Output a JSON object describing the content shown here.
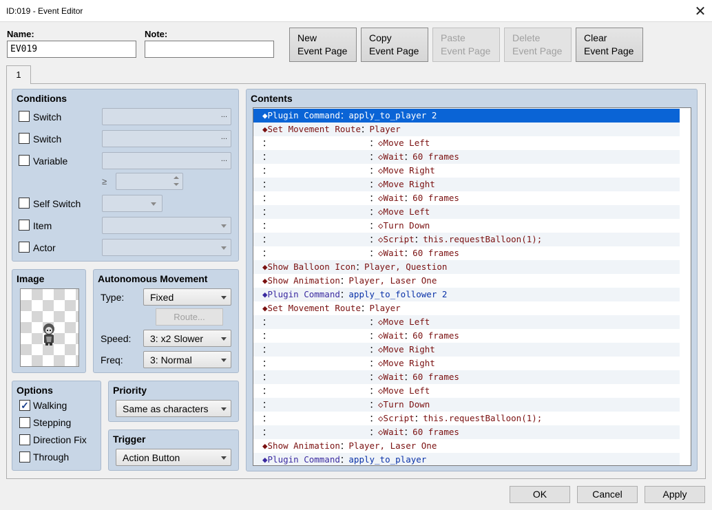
{
  "window": {
    "title": "ID:019 - Event Editor",
    "close_glyph": "✕"
  },
  "header": {
    "name_label": "Name:",
    "name_value": "EV019",
    "note_label": "Note:",
    "note_value": "",
    "buttons": [
      {
        "line1": "New",
        "line2": "Event Page",
        "enabled": true
      },
      {
        "line1": "Copy",
        "line2": "Event Page",
        "enabled": true
      },
      {
        "line1": "Paste",
        "line2": "Event Page",
        "enabled": false
      },
      {
        "line1": "Delete",
        "line2": "Event Page",
        "enabled": false
      },
      {
        "line1": "Clear",
        "line2": "Event Page",
        "enabled": true
      }
    ]
  },
  "tabs": [
    {
      "label": "1"
    }
  ],
  "conditions": {
    "title": "Conditions",
    "switch1_label": "Switch",
    "switch2_label": "Switch",
    "variable_label": "Variable",
    "gte_symbol": "≥",
    "self_switch_label": "Self Switch",
    "item_label": "Item",
    "actor_label": "Actor",
    "ellipsis": "..."
  },
  "image": {
    "title": "Image"
  },
  "autonomous": {
    "title": "Autonomous Movement",
    "type_label": "Type:",
    "type_value": "Fixed",
    "route_button": "Route...",
    "speed_label": "Speed:",
    "speed_value": "3: x2 Slower",
    "freq_label": "Freq:",
    "freq_value": "3: Normal"
  },
  "options": {
    "title": "Options",
    "items": [
      {
        "label": "Walking",
        "checked": true
      },
      {
        "label": "Stepping",
        "checked": false
      },
      {
        "label": "Direction Fix",
        "checked": false
      },
      {
        "label": "Through",
        "checked": false
      }
    ],
    "check_glyph": "✓"
  },
  "priority": {
    "title": "Priority",
    "value": "Same as characters"
  },
  "trigger": {
    "title": "Trigger",
    "value": "Action Button"
  },
  "contents": {
    "title": "Contents",
    "rows": [
      [
        [
          "◆Plugin Command",
          "purple"
        ],
        [
          "：",
          ""
        ],
        [
          "apply_to_player 2",
          "blue"
        ]
      ],
      [
        [
          "◆Set Movement Route",
          "red"
        ],
        [
          "：",
          ""
        ],
        [
          "Player",
          "red"
        ]
      ],
      [
        [
          "：                   ",
          ""
        ],
        [
          "：",
          ""
        ],
        [
          "◇Move Left",
          "red"
        ]
      ],
      [
        [
          "：                   ",
          ""
        ],
        [
          "：",
          ""
        ],
        [
          "◇Wait",
          "red"
        ],
        [
          "：",
          ""
        ],
        [
          "60 frames",
          "red"
        ]
      ],
      [
        [
          "：                   ",
          ""
        ],
        [
          "：",
          ""
        ],
        [
          "◇Move Right",
          "red"
        ]
      ],
      [
        [
          "：                   ",
          ""
        ],
        [
          "：",
          ""
        ],
        [
          "◇Move Right",
          "red"
        ]
      ],
      [
        [
          "：                   ",
          ""
        ],
        [
          "：",
          ""
        ],
        [
          "◇Wait",
          "red"
        ],
        [
          "：",
          ""
        ],
        [
          "60 frames",
          "red"
        ]
      ],
      [
        [
          "：                   ",
          ""
        ],
        [
          "：",
          ""
        ],
        [
          "◇Move Left",
          "red"
        ]
      ],
      [
        [
          "：                   ",
          ""
        ],
        [
          "：",
          ""
        ],
        [
          "◇Turn Down",
          "red"
        ]
      ],
      [
        [
          "：                   ",
          ""
        ],
        [
          "：",
          ""
        ],
        [
          "◇Script",
          "red"
        ],
        [
          "：",
          ""
        ],
        [
          "this.requestBalloon(1);",
          "red"
        ]
      ],
      [
        [
          "：                   ",
          ""
        ],
        [
          "：",
          ""
        ],
        [
          "◇Wait",
          "red"
        ],
        [
          "：",
          ""
        ],
        [
          "60 frames",
          "red"
        ]
      ],
      [
        [
          "◆Show Balloon Icon",
          "red"
        ],
        [
          "：",
          ""
        ],
        [
          "Player, Question",
          "red"
        ]
      ],
      [
        [
          "◆Show Animation",
          "red"
        ],
        [
          "：",
          ""
        ],
        [
          "Player, Laser One",
          "red"
        ]
      ],
      [
        [
          "◆Plugin Command",
          "purple"
        ],
        [
          "：",
          ""
        ],
        [
          "apply_to_follower 2",
          "blue"
        ]
      ],
      [
        [
          "◆Set Movement Route",
          "red"
        ],
        [
          "：",
          ""
        ],
        [
          "Player",
          "red"
        ]
      ],
      [
        [
          "：                   ",
          ""
        ],
        [
          "：",
          ""
        ],
        [
          "◇Move Left",
          "red"
        ]
      ],
      [
        [
          "：                   ",
          ""
        ],
        [
          "：",
          ""
        ],
        [
          "◇Wait",
          "red"
        ],
        [
          "：",
          ""
        ],
        [
          "60 frames",
          "red"
        ]
      ],
      [
        [
          "：                   ",
          ""
        ],
        [
          "：",
          ""
        ],
        [
          "◇Move Right",
          "red"
        ]
      ],
      [
        [
          "：                   ",
          ""
        ],
        [
          "：",
          ""
        ],
        [
          "◇Move Right",
          "red"
        ]
      ],
      [
        [
          "：                   ",
          ""
        ],
        [
          "：",
          ""
        ],
        [
          "◇Wait",
          "red"
        ],
        [
          "：",
          ""
        ],
        [
          "60 frames",
          "red"
        ]
      ],
      [
        [
          "：                   ",
          ""
        ],
        [
          "：",
          ""
        ],
        [
          "◇Move Left",
          "red"
        ]
      ],
      [
        [
          "：                   ",
          ""
        ],
        [
          "：",
          ""
        ],
        [
          "◇Turn Down",
          "red"
        ]
      ],
      [
        [
          "：                   ",
          ""
        ],
        [
          "：",
          ""
        ],
        [
          "◇Script",
          "red"
        ],
        [
          "：",
          ""
        ],
        [
          "this.requestBalloon(1);",
          "red"
        ]
      ],
      [
        [
          "：                   ",
          ""
        ],
        [
          "：",
          ""
        ],
        [
          "◇Wait",
          "red"
        ],
        [
          "：",
          ""
        ],
        [
          "60 frames",
          "red"
        ]
      ],
      [
        [
          "◆Show Animation",
          "red"
        ],
        [
          "：",
          ""
        ],
        [
          "Player, Laser One",
          "red"
        ]
      ],
      [
        [
          "◆Plugin Command",
          "purple"
        ],
        [
          "：",
          ""
        ],
        [
          "apply_to_player",
          "blue"
        ]
      ]
    ],
    "selected_row": 0
  },
  "footer": {
    "ok": "OK",
    "cancel": "Cancel",
    "apply": "Apply"
  }
}
